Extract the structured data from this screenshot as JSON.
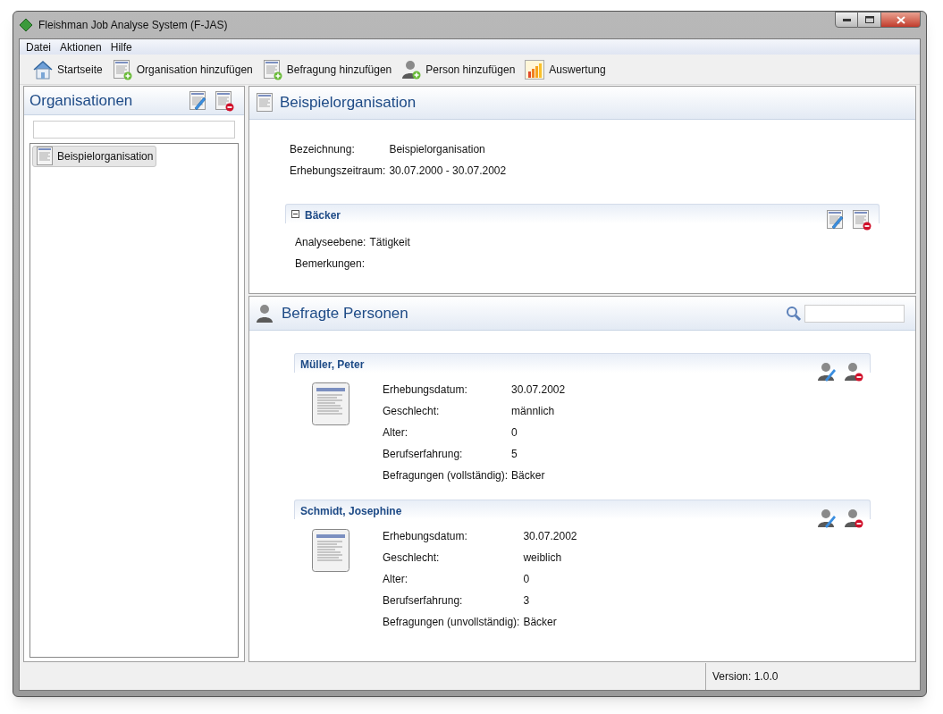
{
  "window": {
    "title": "Fleishman Job Analyse System (F-JAS)"
  },
  "menu": [
    "Datei",
    "Aktionen",
    "Hilfe"
  ],
  "toolbar": [
    {
      "kind": "home",
      "label": "Startseite"
    },
    {
      "kind": "doc-add",
      "label": "Organisation hinzufügen"
    },
    {
      "kind": "doc-add",
      "label": "Befragung hinzufügen"
    },
    {
      "kind": "person-add",
      "label": "Person hinzufügen"
    },
    {
      "kind": "chart",
      "label": "Auswertung"
    }
  ],
  "sidebar": {
    "title": "Organisationen",
    "items": [
      {
        "label": "Beispielorganisation",
        "selected": true
      }
    ]
  },
  "organisation": {
    "title": "Beispielorganisation",
    "fields": [
      {
        "label": "Bezeichnung:",
        "value": "Beispielorganisation"
      },
      {
        "label": "Erhebungszeitraum:",
        "value": "30.07.2000 - 30.07.2002"
      }
    ],
    "sections": [
      {
        "title": "Bäcker",
        "expanded": true,
        "fields": [
          {
            "label": "Analyseebene:",
            "value": "Tätigkeit"
          },
          {
            "label": "Bemerkungen:"
          }
        ]
      }
    ]
  },
  "persons": {
    "title": "Befragte Personen",
    "items": [
      {
        "name": "Müller, Peter",
        "fields": [
          {
            "label": "Erhebungsdatum:",
            "value": "30.07.2002"
          },
          {
            "label": "Geschlecht:",
            "value": "männlich"
          },
          {
            "label": "Alter:",
            "value": "0"
          },
          {
            "label": "Berufserfahrung:",
            "value": "5"
          },
          {
            "label": "Befragungen (vollständig):",
            "value": "Bäcker"
          }
        ]
      },
      {
        "name": "Schmidt, Josephine",
        "fields": [
          {
            "label": "Erhebungsdatum:",
            "value": "30.07.2002"
          },
          {
            "label": "Geschlecht:",
            "value": "weiblich"
          },
          {
            "label": "Alter:",
            "value": "0"
          },
          {
            "label": "Berufserfahrung:",
            "value": "3"
          },
          {
            "label": "Befragungen (unvollständig):",
            "value": "Bäcker"
          }
        ]
      }
    ]
  },
  "status_bar": {
    "version": "Version: 1.0.0"
  }
}
